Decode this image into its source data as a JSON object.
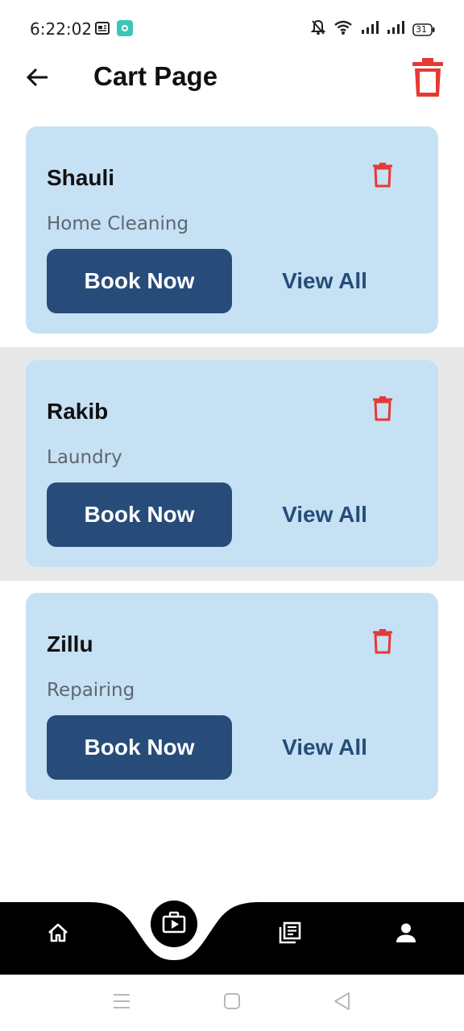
{
  "status_bar": {
    "time": "6:22:02",
    "battery": "31"
  },
  "header": {
    "title": "Cart Page"
  },
  "cart_items": [
    {
      "name": "Shauli",
      "service": "Home Cleaning",
      "book_label": "Book Now",
      "view_label": "View All"
    },
    {
      "name": "Rakib",
      "service": "Laundry",
      "book_label": "Book Now",
      "view_label": "View All"
    },
    {
      "name": "Zillu",
      "service": "Repairing",
      "book_label": "Book Now",
      "view_label": "View All"
    }
  ],
  "bottom_nav": {
    "items": [
      "home-icon",
      "bookings-icon",
      "news-icon",
      "profile-icon"
    ]
  },
  "colors": {
    "card_bg": "#c6e1f4",
    "primary": "#274c7a",
    "delete": "#e53935",
    "nav_bg": "#000000"
  }
}
